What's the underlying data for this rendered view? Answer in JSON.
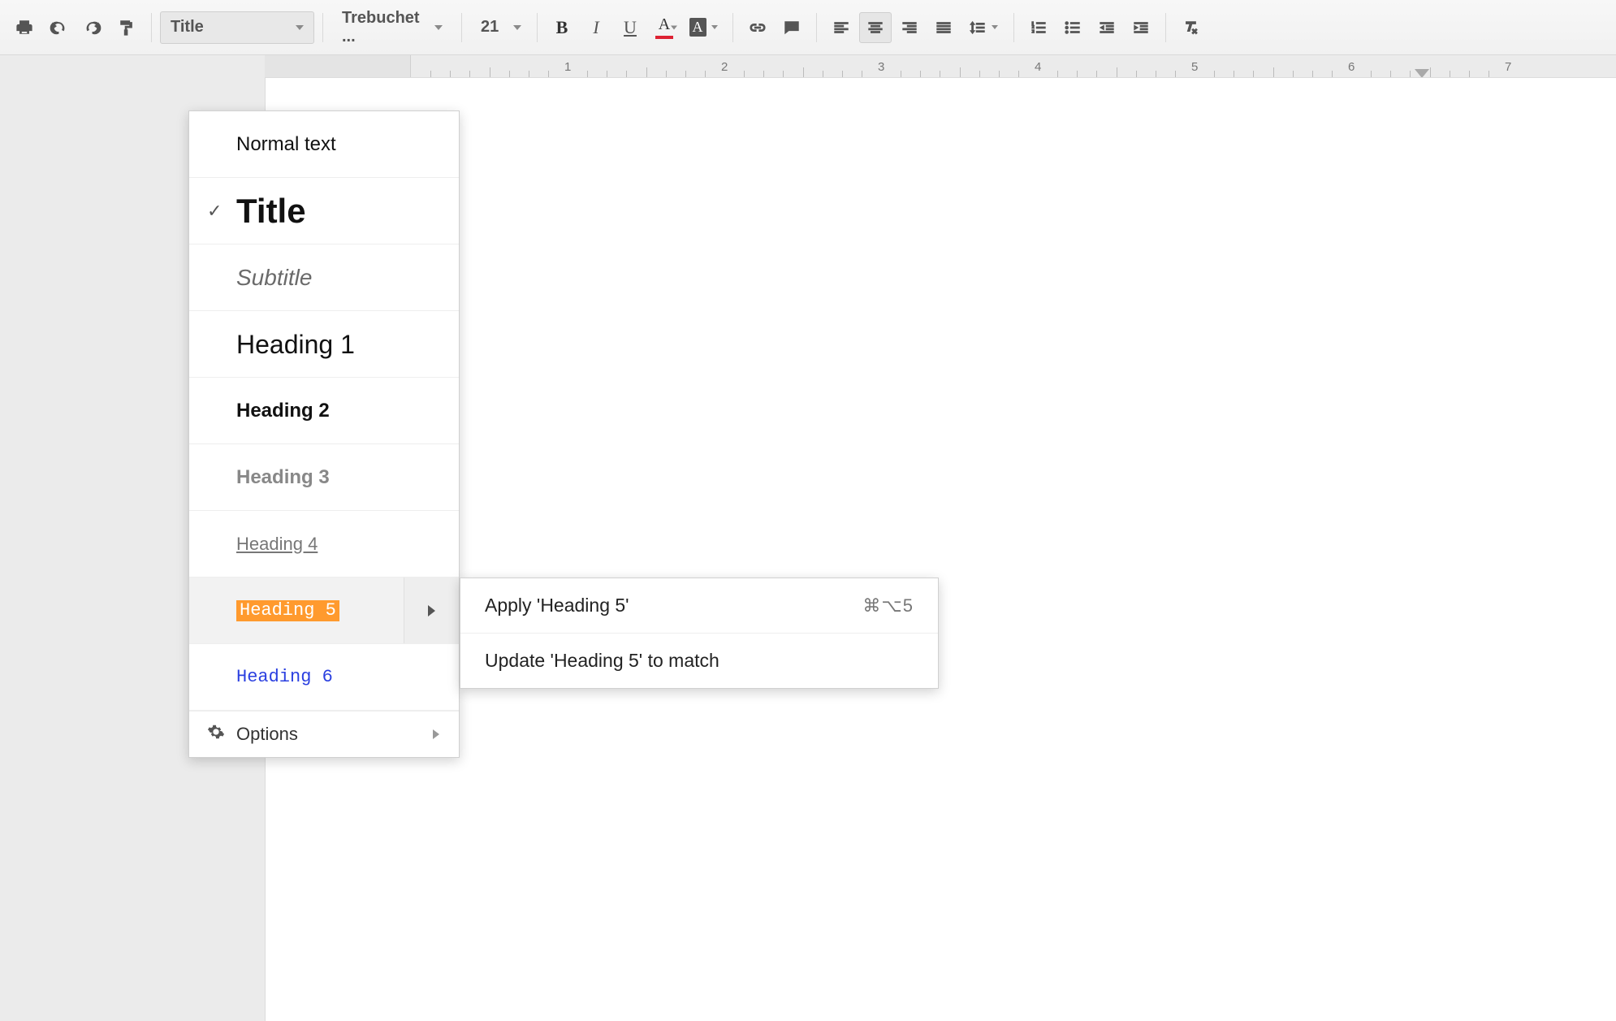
{
  "toolbar": {
    "style_select": "Title",
    "font_select": "Trebuchet ...",
    "size_select": "21",
    "bold": "B",
    "italic": "I",
    "underline": "U",
    "text_color": "A",
    "highlight": "A"
  },
  "ruler": {
    "marks": [
      "1",
      "2",
      "3",
      "4",
      "5",
      "6",
      "7"
    ]
  },
  "style_menu": {
    "items": [
      {
        "label": "Normal text",
        "cls": "style-normal",
        "checked": false
      },
      {
        "label": "Title",
        "cls": "style-title",
        "checked": true
      },
      {
        "label": "Subtitle",
        "cls": "style-subtitle",
        "checked": false
      },
      {
        "label": "Heading 1",
        "cls": "style-h1",
        "checked": false
      },
      {
        "label": "Heading 2",
        "cls": "style-h2",
        "checked": false
      },
      {
        "label": "Heading 3",
        "cls": "style-h3",
        "checked": false
      },
      {
        "label": "Heading 4",
        "cls": "style-h4",
        "checked": false
      },
      {
        "label": "Heading 5",
        "cls": "style-h5",
        "checked": false,
        "hover": true,
        "expand": true
      },
      {
        "label": "Heading 6",
        "cls": "style-h6",
        "checked": false
      }
    ],
    "options_label": "Options"
  },
  "submenu": {
    "apply_label": "Apply 'Heading 5'",
    "apply_shortcut": "⌘⌥5",
    "update_label": "Update 'Heading 5' to match"
  }
}
